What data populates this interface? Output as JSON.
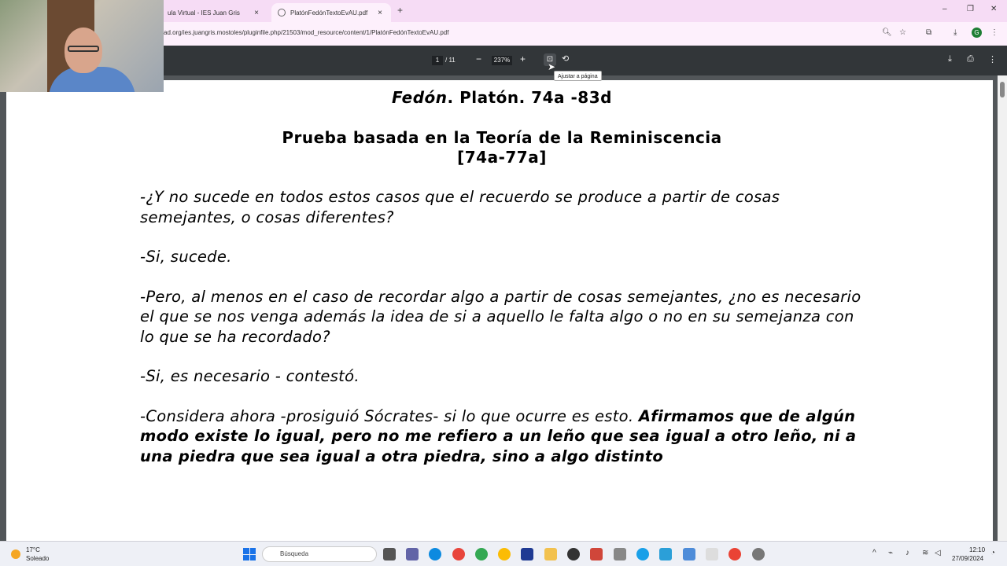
{
  "browser": {
    "tabs": [
      {
        "label": "ula Virtual - IES Juan Gris",
        "close": "×"
      },
      {
        "label": "PlatónFedónTextoEvAU.pdf",
        "close": "×"
      }
    ],
    "new_tab": "+",
    "window_controls": {
      "minimize": "–",
      "maximize": "❐",
      "close": "✕"
    },
    "url": "ad.org/ies.juangris.mostoles/pluginfile.php/21503/mod_resource/content/1/PlatónFedónTextoEvAU.pdf",
    "profile_initial": "G"
  },
  "pdf_toolbar": {
    "page_current": "1",
    "page_total": "/ 11",
    "zoom_minus": "−",
    "zoom_value": "237%",
    "zoom_plus": "+",
    "tooltip": "Ajustar a página"
  },
  "document": {
    "title_italic": "Fedón",
    "title_rest": ". Platón. 74a -83d",
    "subtitle_line1": "Prueba basada en la Teoría de la Reminiscencia",
    "subtitle_line2": "[74a-77a]",
    "p1": "-¿Y no sucede en todos estos casos que el recuerdo se produce a partir de cosas semejantes, o cosas diferentes?",
    "p2": "-Si, sucede.",
    "p3": "-Pero, al menos en el caso de recordar algo a partir de cosas semejantes, ¿no es necesario el que se nos venga además la idea de si a aquello le falta algo o no en su semejanza con lo que se ha recordado?",
    "p4": "-Si, es necesario - contestó.",
    "p5_plain": "-Considera ahora -prosiguió Sócrates- si lo que ocurre es esto. ",
    "p5_bold": "Afirmamos que de algún modo existe lo igual, pero no me refiero a un leño que sea igual a otro leño, ni a una piedra que sea igual a otra piedra, sino a algo distinto"
  },
  "taskbar": {
    "weather_temp": "17°C",
    "weather_desc": "Soleado",
    "search_placeholder": "Búsqueda",
    "time": "12:10",
    "date": "27/09/2024"
  }
}
